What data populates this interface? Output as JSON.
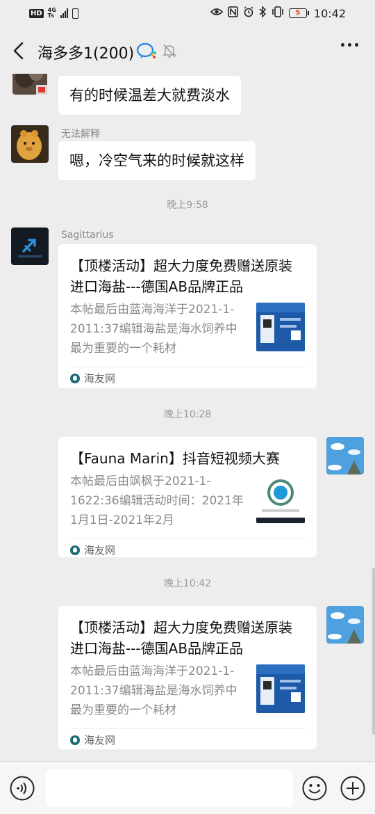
{
  "status_bar": {
    "hd": "HD",
    "network_top": "4G",
    "network_bottom": "Ts",
    "battery_level": "5",
    "time": "10:42"
  },
  "header": {
    "title": "海多多1(200)",
    "back_icon": "chevron-left-icon",
    "more_icon": "more-dots-icon"
  },
  "chat": {
    "messages": [
      {
        "text": "有的时候温差大就费淡水"
      },
      {
        "sender": "无法解释",
        "text": "嗯，冷空气来的时候就这样"
      }
    ],
    "times": [
      "晚上9:58",
      "晚上10:28",
      "晚上10:42"
    ],
    "cards": [
      {
        "sender": "Sagittarius",
        "title": "【顶楼活动】超大力度免费赠送原装进口海盐---德国AB品牌正品",
        "desc": "本帖最后由蓝海海洋于2021-1-2011:37编辑海盐是海水饲养中最为重要的一个耗材",
        "source": "海友网"
      },
      {
        "title": "【Fauna Marin】抖音短视频大赛",
        "desc": "本帖最后由飒枫于2021-1-1622:36编辑活动时间：2021年1月1日-2021年2月",
        "source": "海友网"
      },
      {
        "title": "【顶楼活动】超大力度免费赠送原装进口海盐---德国AB品牌正品",
        "desc": "本帖最后由蓝海海洋于2021-1-2011:37编辑海盐是海水饲养中最为重要的一个耗材",
        "source": "海友网"
      }
    ]
  },
  "input_bar": {
    "voice_icon": "voice-icon",
    "emoji_icon": "emoji-icon",
    "plus_icon": "plus-icon",
    "placeholder": ""
  },
  "colors": {
    "background": "#ededed",
    "bubble": "#ffffff",
    "secondary_text": "#888888",
    "battery_low": "#e0502a"
  }
}
